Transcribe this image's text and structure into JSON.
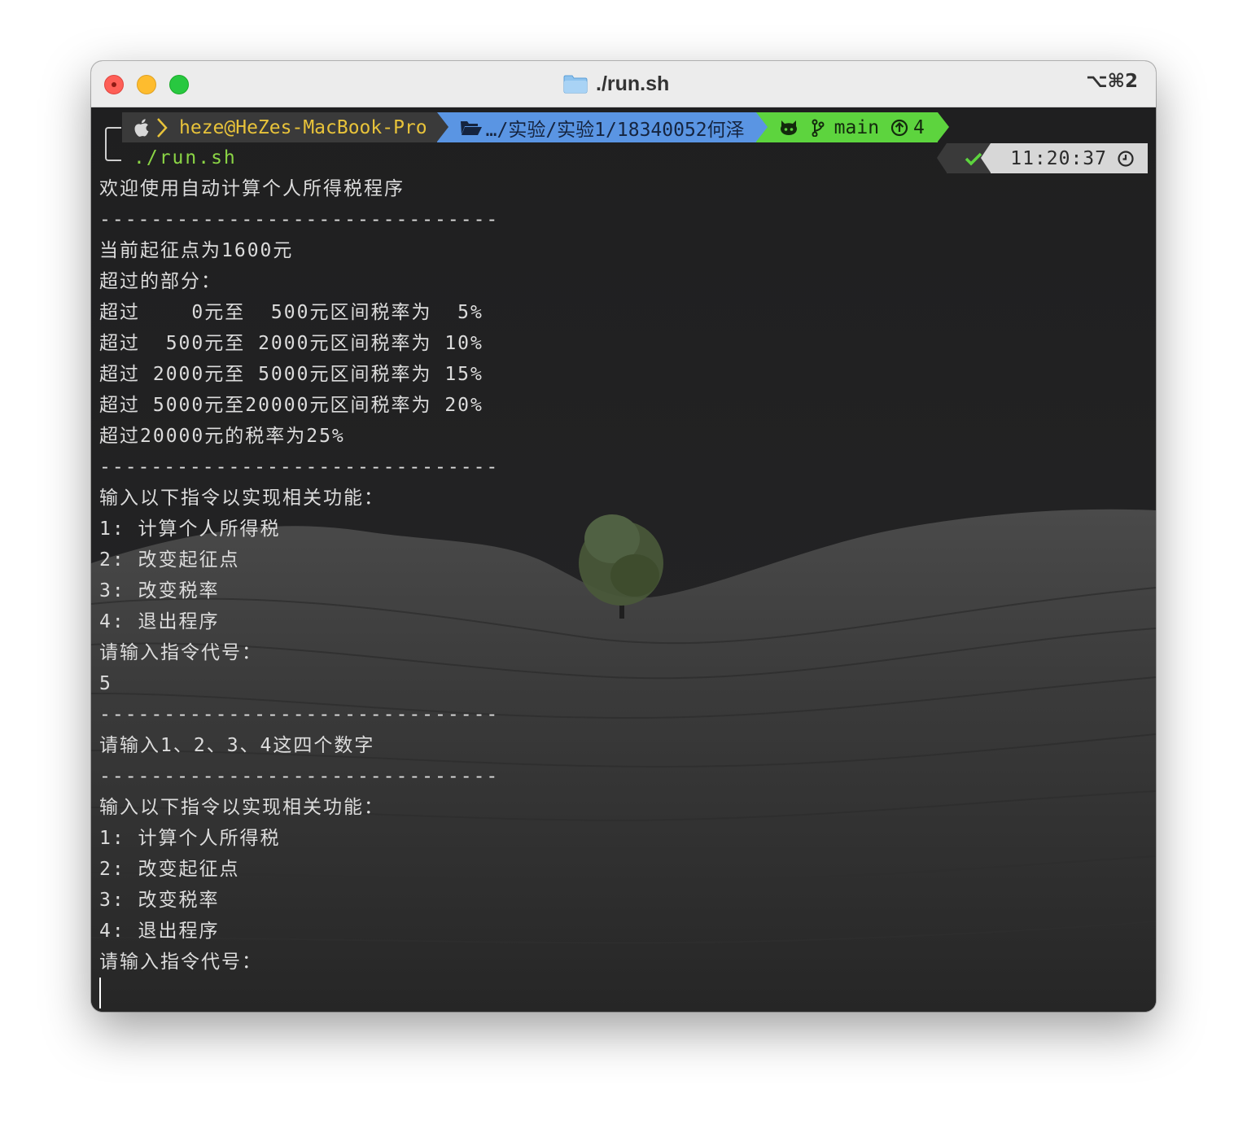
{
  "window": {
    "title": "./run.sh",
    "shortcut": "⌥⌘2"
  },
  "prompt": {
    "user_host": "heze@HeZes-MacBook-Pro",
    "path": "…/实验/实验1/18340052何泽",
    "git_branch": "main",
    "git_ahead": "4",
    "command": "./run.sh",
    "time": "11:20:37"
  },
  "output": {
    "welcome": "欢迎使用自动计算个人所得税程序",
    "separator": "-------------------------------",
    "threshold": "当前起征点为1600元",
    "over_parts": "超过的部分：",
    "bracket1": "超过    0元至  500元区间税率为  5%",
    "bracket2": "超过  500元至 2000元区间税率为 10%",
    "bracket3": "超过 2000元至 5000元区间税率为 15%",
    "bracket4": "超过 5000元至20000元区间税率为 20%",
    "bracket5": "超过20000元的税率为25%",
    "menu_title": "输入以下指令以实现相关功能：",
    "menu1": "1: 计算个人所得税",
    "menu2": "2: 改变起征点",
    "menu3": "3: 改变税率",
    "menu4": "4: 退出程序",
    "ask": "请输入指令代号：",
    "input_value": "5",
    "error": "请输入1、2、3、4这四个数字"
  },
  "colors": {
    "user_segment": "#3a3a3a",
    "user_text": "#e8c33a",
    "path_segment": "#5a95e3",
    "git_segment": "#5dd43e",
    "command_text": "#8bd545",
    "terminal_text": "#dcdcdc"
  },
  "icons": [
    "apple-icon",
    "chevron-right-icon",
    "folder-open-icon",
    "github-icon",
    "git-branch-icon",
    "arrow-up-circle-icon",
    "checkmark-icon",
    "clock-icon",
    "folder-icon"
  ]
}
